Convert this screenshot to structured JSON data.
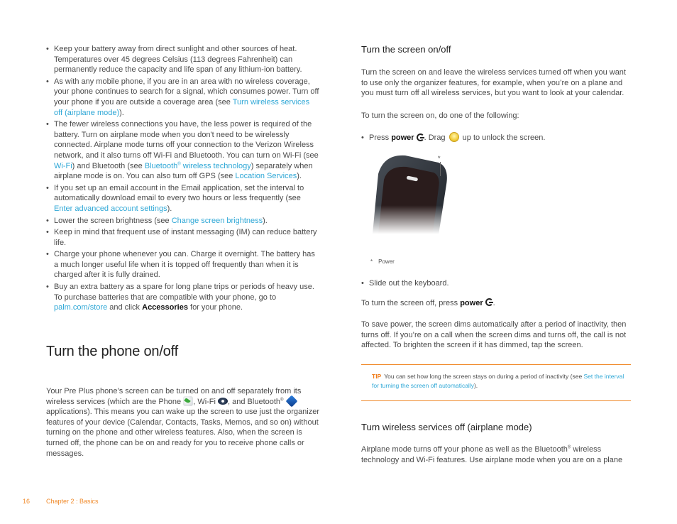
{
  "left_column": {
    "bullets": [
      {
        "parts": [
          {
            "text": "Keep your battery away from direct sunlight and other sources of heat. Temperatures over 45 degrees Celsius (113 degrees Fahrenheit) can permanently reduce the capacity and life span of any lithium-ion battery."
          }
        ]
      },
      {
        "parts": [
          {
            "text": "As with any mobile phone, if you are in an area with no wireless coverage, your phone continues to search for a signal, which consumes power. Turn off your phone if you are outside a coverage area (see "
          },
          {
            "link": "Turn wireless services off (airplane mode)"
          },
          {
            "text": ")."
          }
        ]
      },
      {
        "parts": [
          {
            "text": "The fewer wireless connections you have, the less power is required of the battery. Turn on airplane mode when you don't need to be wirelessly connected. Airplane mode turns off your connection to the Verizon Wireless network, and it also turns off Wi-Fi and Bluetooth. You can turn on Wi-Fi (see "
          },
          {
            "link": "Wi-Fi"
          },
          {
            "text": ") and Bluetooth (see "
          },
          {
            "link": "Bluetooth® wireless technology"
          },
          {
            "text": ") separately when airplane mode is on. You can also turn off GPS (see "
          },
          {
            "link": "Location Services"
          },
          {
            "text": ")."
          }
        ]
      },
      {
        "parts": [
          {
            "text": "If you set up an email account in the Email application, set the interval to automatically download email to every two hours or less frequently (see "
          },
          {
            "link": "Enter advanced account settings"
          },
          {
            "text": ")."
          }
        ]
      },
      {
        "parts": [
          {
            "text": "Lower the screen brightness (see "
          },
          {
            "link": "Change screen brightness"
          },
          {
            "text": ")."
          }
        ]
      },
      {
        "parts": [
          {
            "text": "Keep in mind that frequent use of instant messaging (IM) can reduce battery life."
          }
        ]
      },
      {
        "parts": [
          {
            "text": "Charge your phone whenever you can. Charge it overnight. The battery has a much longer useful life when it is topped off frequently than when it is charged after it is fully drained."
          }
        ]
      },
      {
        "parts": [
          {
            "text": "Buy an extra battery as a spare for long plane trips or periods of heavy use. To purchase batteries that are compatible with your phone, go to "
          },
          {
            "link": "palm.com/store"
          },
          {
            "text": " and click "
          },
          {
            "bold": "Accessories"
          },
          {
            "text": " for your phone."
          }
        ]
      }
    ],
    "section_title": "Turn the phone on/off",
    "intro": {
      "t1": "Your Pre Plus phone’s screen can be turned on and off separately from its wireless services (which are the Phone ",
      "t2": ", Wi-Fi ",
      "t3": ", and Bluetooth",
      "reg": "®",
      "t4": " applications). This means you can wake up the screen to use just the organizer features of your device (Calendar, Contacts, Tasks, Memos, and so on) without turning on the phone and other wireless features. Also, when the screen is turned off, the phone can be on and ready for you to receive phone calls or messages.",
      "icons": [
        "phone-app-icon",
        "wifi-app-icon",
        "bluetooth-app-icon"
      ]
    }
  },
  "right_column": {
    "screen_section": {
      "title": "Turn the screen on/off",
      "para1": "Turn the screen on and leave the wireless services turned off when you want to use only the organizer features, for example, when you’re on a plane and you must turn off all wireless services, but you want to look at your calendar.",
      "para2": "To turn the screen on, do one of the following:",
      "bullet1": {
        "t1": "Press ",
        "bold": "power",
        "t2": ". Drag ",
        "t3": " up to unlock the screen.",
        "icons": [
          "power-icon",
          "unlock-icon"
        ]
      },
      "image_callout": "*",
      "caption_star": "*",
      "caption": "Power",
      "bullet2": "Slide out the keyboard.",
      "off": {
        "t1": "To turn the screen off, press ",
        "bold": "power",
        "t2": "."
      },
      "para3": "To save power, the screen dims automatically after a period of inactivity, then turns off. If you’re on a call when the screen dims and turns off, the call is not affected. To brighten the screen if it has dimmed, tap the screen."
    },
    "tip": {
      "label": "TIP",
      "text": "You can set how long the screen stays on during a period of inactivity (see ",
      "link": "Set the interval for turning the screen off automatically",
      "end": ")."
    },
    "airplane_section": {
      "title": "Turn wireless services off (airplane mode)",
      "t1": "Airplane mode turns off your phone as well as the Bluetooth",
      "reg": "®",
      "t2": " wireless technology and Wi-Fi features. Use airplane mode when you are on a plane"
    }
  },
  "footer": {
    "page_number": "16",
    "chapter": "Chapter 2  :  Basics"
  },
  "colors": {
    "link": "#2ea7d6",
    "accent_orange": "#f08a2a",
    "body_text": "#4a4a4a",
    "heading": "#222222"
  }
}
